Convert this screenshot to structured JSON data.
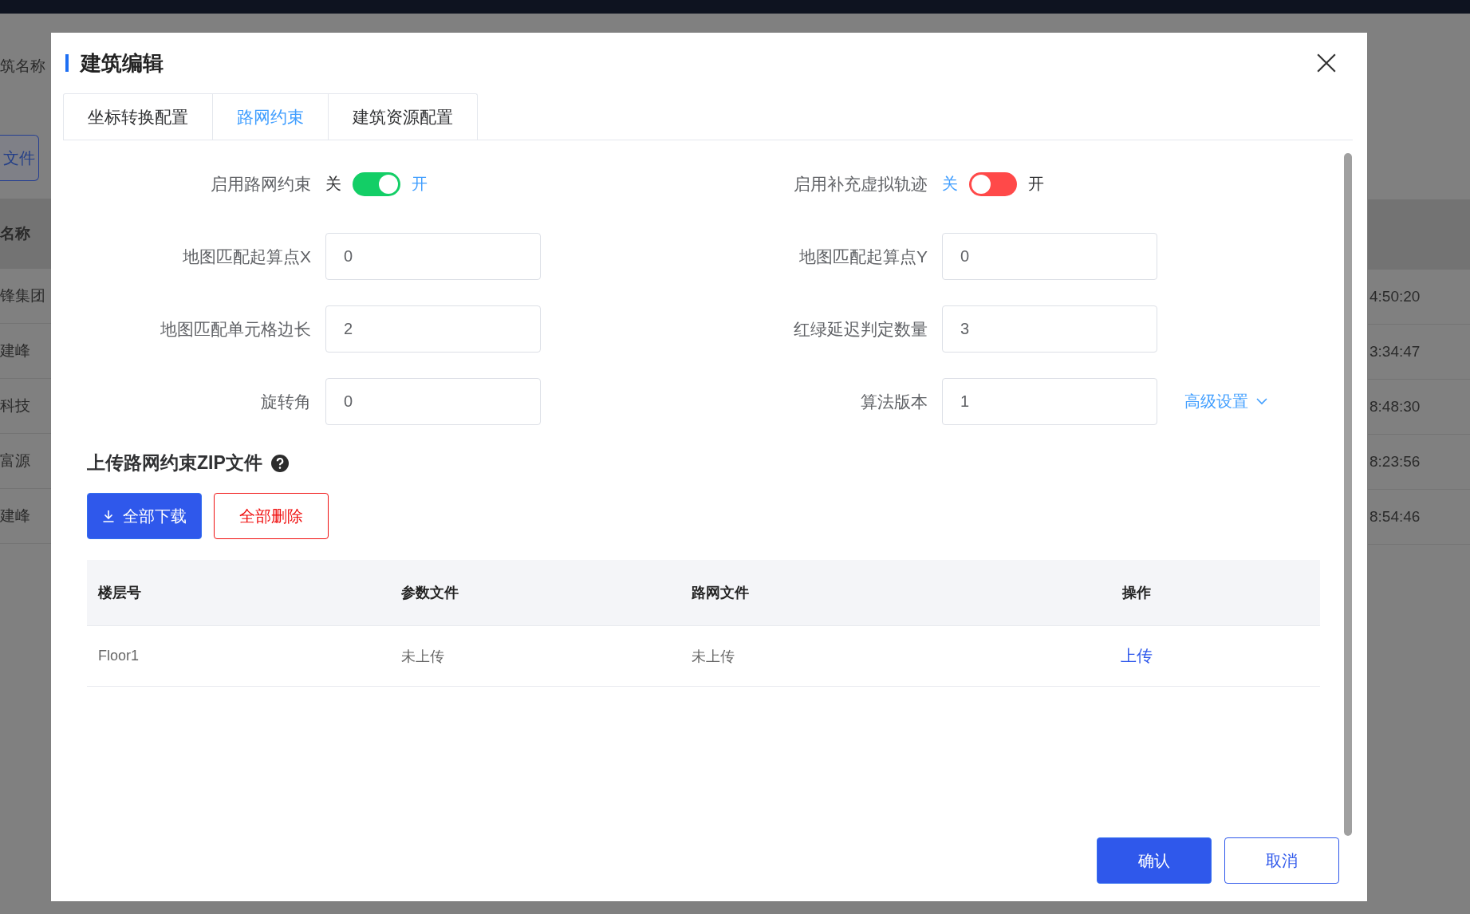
{
  "background": {
    "filter_label": "筑名称",
    "button": "文件",
    "column_header": "名称",
    "rows": [
      {
        "name": "锋集团",
        "time": "4:50:20"
      },
      {
        "name": "建峰",
        "time": "3:34:47"
      },
      {
        "name": "科技",
        "time": "8:48:30"
      },
      {
        "name": "富源",
        "time": "8:23:56"
      },
      {
        "name": "建峰",
        "time": "8:54:46"
      }
    ]
  },
  "dialog": {
    "title": "建筑编辑",
    "tabs": [
      {
        "label": "坐标转换配置",
        "selected": false
      },
      {
        "label": "路网约束",
        "selected": true
      },
      {
        "label": "建筑资源配置",
        "selected": false
      }
    ],
    "switches": [
      {
        "label": "启用路网约束",
        "off_text": "关",
        "on_text": "开",
        "on": true
      },
      {
        "label": "启用补充虚拟轨迹",
        "off_text": "关",
        "on_text": "开",
        "on": false
      }
    ],
    "fields": [
      {
        "label": "地图匹配起算点X",
        "value": "0"
      },
      {
        "label": "地图匹配起算点Y",
        "value": "0"
      },
      {
        "label": "地图匹配单元格边长",
        "value": "2"
      },
      {
        "label": "红绿延迟判定数量",
        "value": "3"
      },
      {
        "label": "旋转角",
        "value": "0"
      },
      {
        "label": "算法版本",
        "value": "1"
      }
    ],
    "advanced_link": "高级设置",
    "upload": {
      "title": "上传路网约束ZIP文件",
      "buttons": [
        {
          "label": "全部下载",
          "kind": "primary"
        },
        {
          "label": "全部删除",
          "kind": "danger"
        }
      ],
      "table": {
        "columns": [
          "楼层号",
          "参数文件",
          "路网文件",
          "操作"
        ],
        "rows": [
          {
            "cells": [
              "Floor1",
              "未上传",
              "未上传"
            ],
            "action": "上传"
          }
        ]
      }
    },
    "footer": [
      {
        "label": "确认",
        "kind": "primary"
      },
      {
        "label": "取消",
        "kind": "default"
      }
    ]
  }
}
